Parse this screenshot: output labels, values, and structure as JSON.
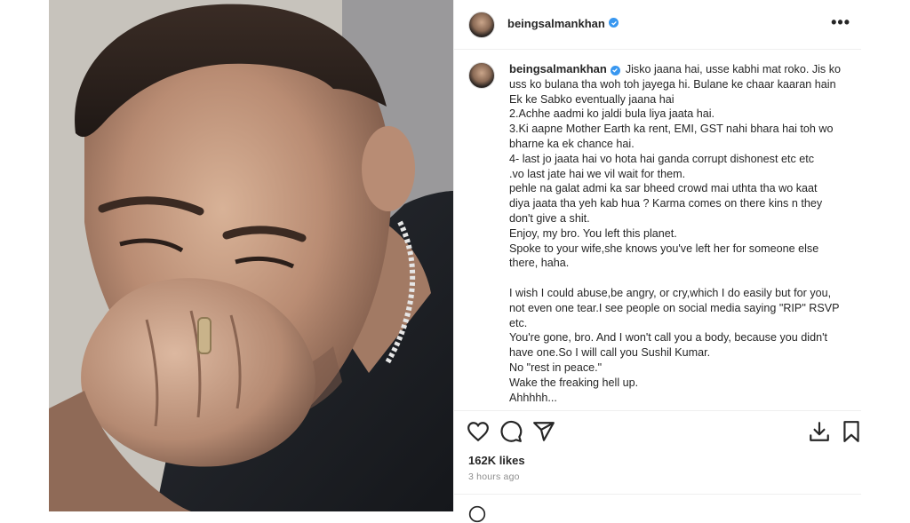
{
  "post": {
    "username": "beingsalmankhan",
    "more_icon": "more-icon",
    "caption_lines": [
      "Jisko jaana hai, usse kabhi mat roko. Jis ko",
      "uss ko bulana tha woh toh jayega hi. Bulane ke chaar kaaran hain",
      "Ek ke Sabko eventually jaana hai",
      "2.Achhe aadmi ko jaldi bula liya jaata hai.",
      "3.Ki aapne Mother Earth ka rent, EMI, GST nahi bhara hai toh wo",
      "bharne ka ek chance hai.",
      "4- last jo jaata hai vo hota hai ganda corrupt dishonest etc etc",
      ".vo last jate hai we vil wait for them.",
      "pehle na galat admi ka sar bheed crowd mai uthta tha wo kaat",
      "diya jaata tha yeh kab hua ? Karma comes on there kins n they",
      "don't give a shit.",
      "Enjoy, my bro. You left this planet.",
      "Spoke to your wife,she knows you've left her for someone else",
      "there, haha.",
      "",
      "I wish I could abuse,be angry, or cry,which I do easily but for you,",
      "not even one tear.I see people on social media saying \"RIP\" RSVP",
      "etc.",
      "You're gone, bro. And I won't call you a body, because you didn't",
      "have one.So I will call you Sushil Kumar.",
      "No \"rest in peace.\"",
      "Wake the freaking hell up.",
      "Ahhhhh..."
    ],
    "likes": "162K likes",
    "time_ago": "3 hours ago"
  },
  "icons": {
    "verified": "verified-badge-icon",
    "like": "heart-icon",
    "comment": "comment-icon",
    "share": "share-icon",
    "download": "download-icon",
    "save": "bookmark-icon"
  },
  "colors": {
    "verified": "#3897f0",
    "text": "#262626",
    "muted": "#8e8e8e",
    "border": "#efefef"
  }
}
